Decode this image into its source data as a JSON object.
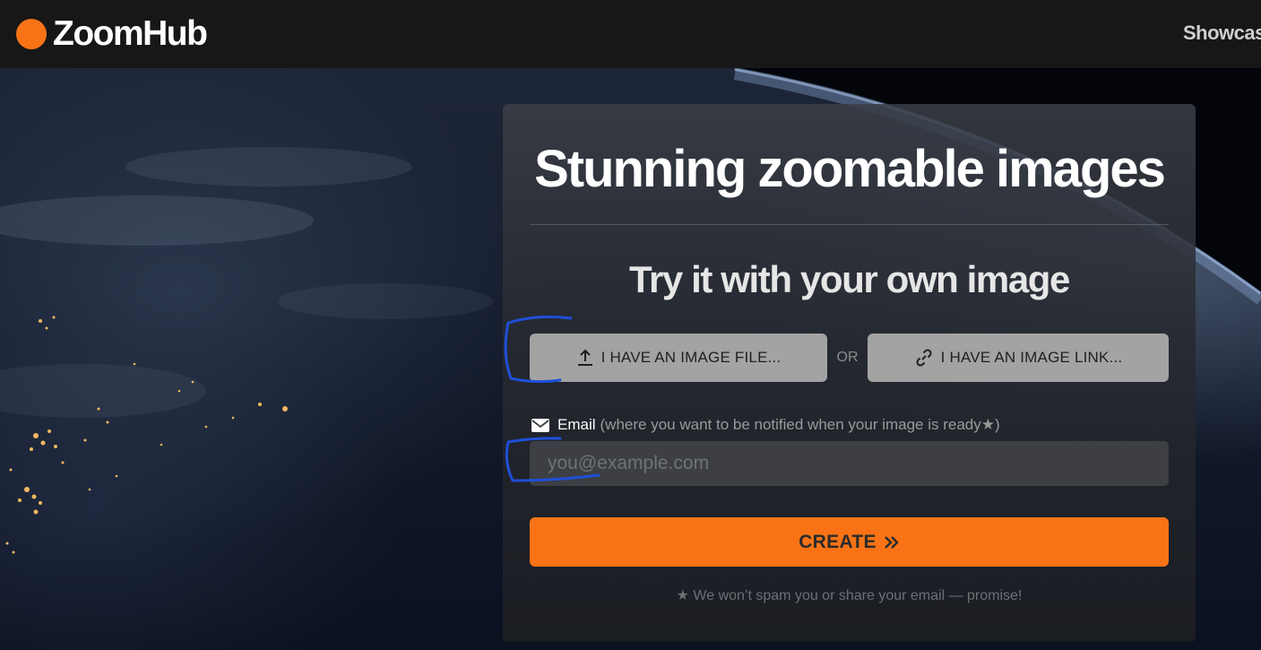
{
  "header": {
    "logo_text": "ZoomHub",
    "nav_link": "Showcas"
  },
  "hero": {
    "title": "Stunning zoomable images",
    "subtitle": "Try it with your own image"
  },
  "upload": {
    "file_button_label": "I HAVE AN IMAGE FILE...",
    "or_label": "OR",
    "link_button_label": "I HAVE AN IMAGE LINK..."
  },
  "email": {
    "label": "Email",
    "hint": "(where you want to be notified when your image is ready★)",
    "placeholder": "you@example.com"
  },
  "create_button_label": "CREATE",
  "note": "★ We won’t spam you or share your email — promise!",
  "colors": {
    "accent": "#f97316",
    "topbar": "#171717",
    "button_gray": "#a3a3a3",
    "annotation_blue": "#1f4fd8"
  },
  "icons": {
    "upload": "upload-icon",
    "link": "link-icon",
    "email": "envelope-icon",
    "create": "double-chevron-right-icon"
  }
}
